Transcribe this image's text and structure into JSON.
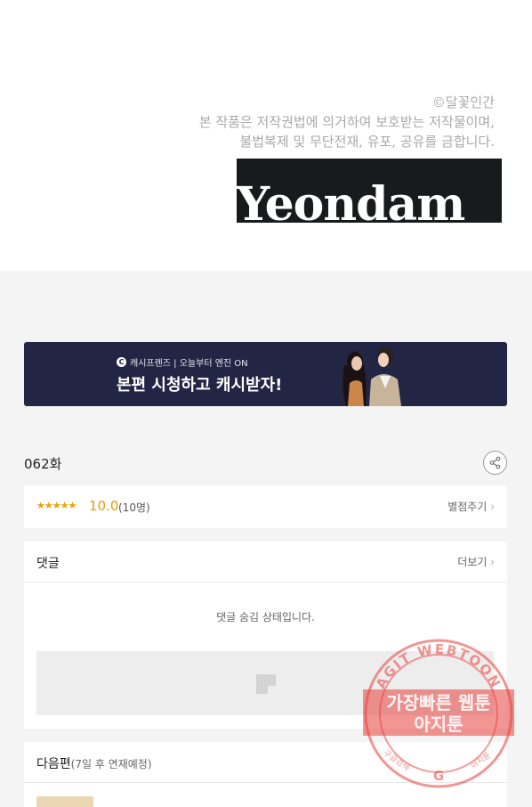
{
  "copyright": {
    "line1": "©달꽃인간",
    "line2": "본 작품은 저작권법에 의거하여 보호받는 저작물이며,",
    "line3": "불법복제 및 무단전재, 유포, 공유를 금합니다."
  },
  "logo_text": "Yeondam",
  "banner": {
    "sub": "캐시프렌즈 | 오늘부터 엔진 ON",
    "main": "본편 시청하고 캐시받자!",
    "logo_glyph": "C",
    "accent": "#222543"
  },
  "episode": {
    "title": "062화",
    "share_icon": "share-icon"
  },
  "rating": {
    "stars": "★★★★★",
    "score": "10.0",
    "count": "(10명)",
    "link": "별점주기",
    "accent": "#e79a10"
  },
  "comments": {
    "title": "댓글",
    "more": "더보기",
    "hidden_msg": "댓글 숨김 상태입니다."
  },
  "next": {
    "title": "다음편",
    "note": "(7일 후 연재예정)"
  },
  "watermark": {
    "arc_text": "AGIT WEBTOON",
    "line1": "가장빠른 웹툰",
    "line2": "아지툰",
    "left_small": "구글검색",
    "right_small": "아지툰",
    "g": "G",
    "color": "#e8403c"
  }
}
